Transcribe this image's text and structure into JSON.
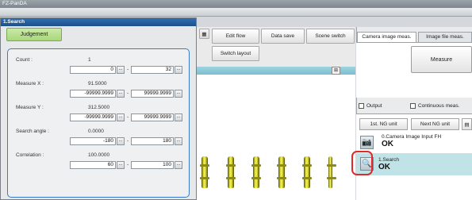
{
  "app": {
    "title": "FZ-PanDA"
  },
  "dialog": {
    "title": "1.Search",
    "tab_label": "Judgement",
    "fields": [
      {
        "label": "Count :",
        "value": "1",
        "min": "0",
        "max": "32"
      },
      {
        "label": "Measure X :",
        "value": "91.5000",
        "min": "-99999.9999",
        "max": "99999.9999"
      },
      {
        "label": "Measure Y :",
        "value": "312.5000",
        "min": "-99999.9999",
        "max": "99999.9999"
      },
      {
        "label": "Search angle :",
        "value": "0.0000",
        "min": "-180",
        "max": "180"
      },
      {
        "label": "Correlation :",
        "value": "100.0000",
        "min": "60",
        "max": "100"
      }
    ],
    "range_dash": "-",
    "dots_label": "..."
  },
  "toolbar": {
    "edit_flow": "Edit flow",
    "data_save": "Data save",
    "scene_switch": "Scene switch",
    "switch_layout": "Switch layout"
  },
  "right_panel": {
    "tabs": [
      "Camera image meas.",
      "Image file meas."
    ],
    "measure_label": "Measure",
    "output_label": "Output",
    "continuous_label": "Continuous meas.",
    "nav": [
      "1st. NG unit",
      "Next NG unit"
    ],
    "units": [
      {
        "name": "0.Camera Image Input FH",
        "result": "OK"
      },
      {
        "name": "1.Search",
        "result": "OK"
      }
    ]
  }
}
